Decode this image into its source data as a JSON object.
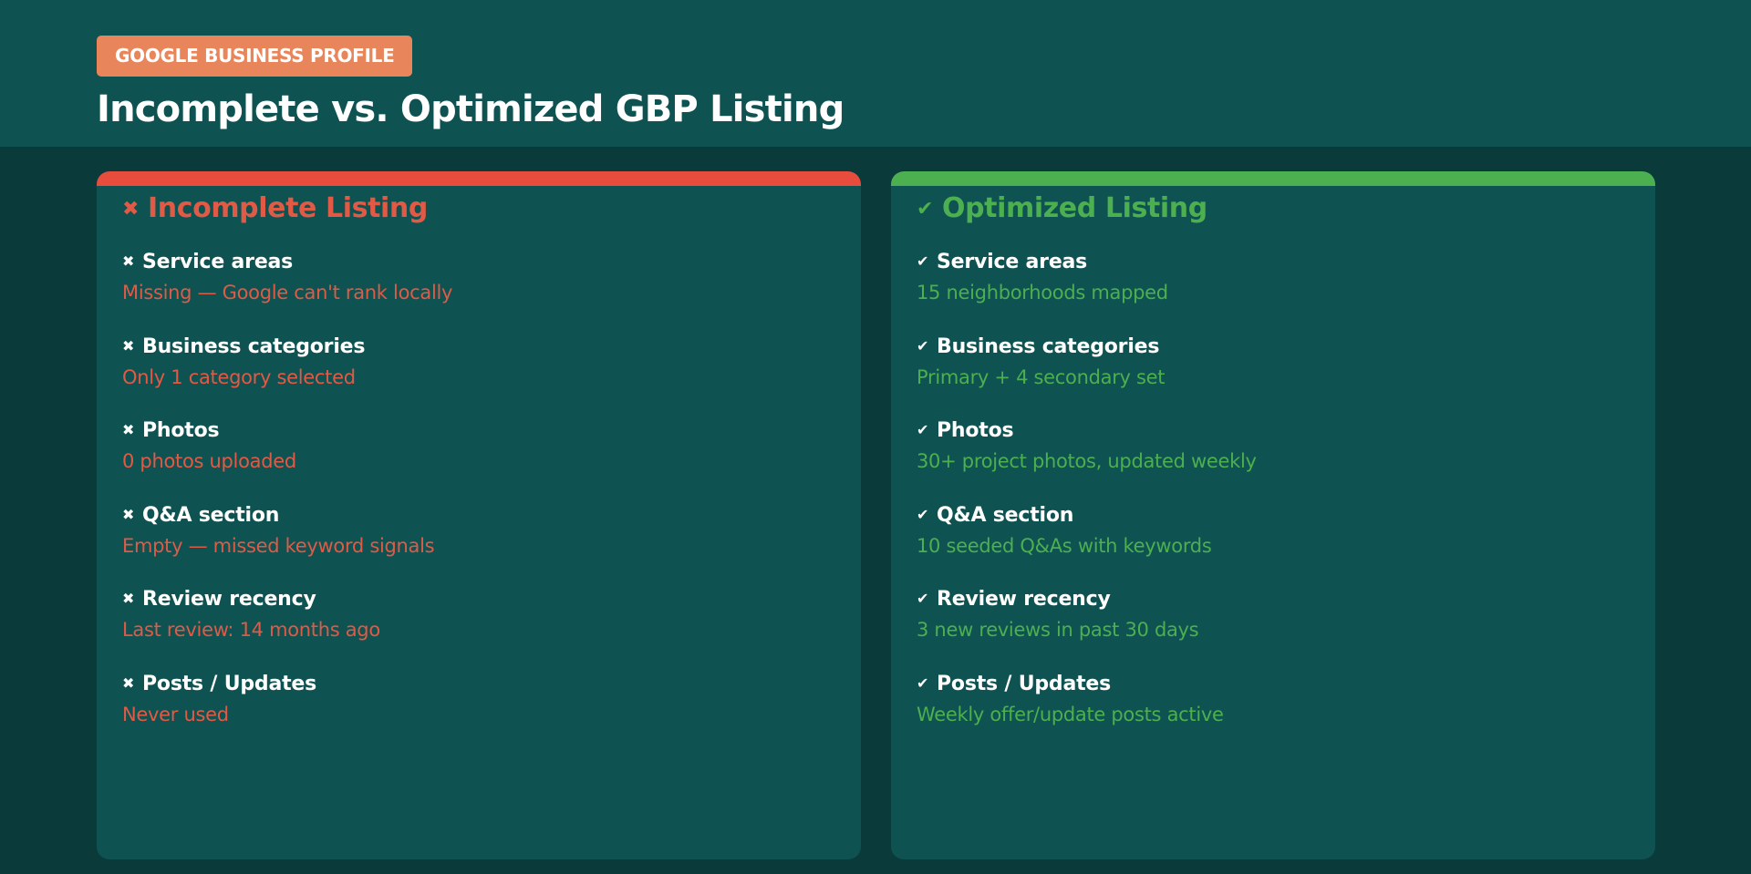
{
  "header": {
    "badge": "GOOGLE BUSINESS PROFILE",
    "title": "Incomplete vs. Optimized GBP Listing"
  },
  "colors": {
    "incomplete": "#e74c3c",
    "optimized": "#4caf50"
  },
  "incomplete": {
    "icon": "cross-icon",
    "glyph": "✖",
    "title": "Incomplete Listing",
    "items": [
      {
        "glyph": "✖",
        "label": "Service areas",
        "value": "Missing — Google can't rank locally"
      },
      {
        "glyph": "✖",
        "label": "Business categories",
        "value": "Only 1 category selected"
      },
      {
        "glyph": "✖",
        "label": "Photos",
        "value": "0 photos uploaded"
      },
      {
        "glyph": "✖",
        "label": "Q&A section",
        "value": "Empty — missed keyword signals"
      },
      {
        "glyph": "✖",
        "label": "Review recency",
        "value": "Last review: 14 months ago"
      },
      {
        "glyph": "✖",
        "label": "Posts / Updates",
        "value": "Never used"
      }
    ]
  },
  "optimized": {
    "icon": "check-icon",
    "glyph": "✔",
    "title": "Optimized Listing",
    "items": [
      {
        "glyph": "✔",
        "label": "Service areas",
        "value": "15 neighborhoods mapped"
      },
      {
        "glyph": "✔",
        "label": "Business categories",
        "value": "Primary + 4 secondary set"
      },
      {
        "glyph": "✔",
        "label": "Photos",
        "value": "30+ project photos, updated weekly"
      },
      {
        "glyph": "✔",
        "label": "Q&A section",
        "value": "10 seeded Q&As with keywords"
      },
      {
        "glyph": "✔",
        "label": "Review recency",
        "value": "3 new reviews in past 30 days"
      },
      {
        "glyph": "✔",
        "label": "Posts / Updates",
        "value": "Weekly offer/update posts active"
      }
    ]
  }
}
